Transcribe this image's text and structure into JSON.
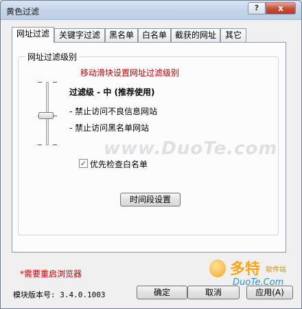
{
  "window": {
    "title": "黄色过滤"
  },
  "titlebar": {
    "help_label": "?",
    "close_label": "x"
  },
  "tabs": [
    {
      "label": "网址过滤",
      "active": true
    },
    {
      "label": "关键字过滤",
      "active": false
    },
    {
      "label": "黑名单",
      "active": false
    },
    {
      "label": "白名单",
      "active": false
    },
    {
      "label": "截获的网址",
      "active": false
    },
    {
      "label": "其它",
      "active": false
    }
  ],
  "group": {
    "title": "网址过滤级别",
    "hint": "移动滑块设置网址过滤级别",
    "level_title": "过滤级 - 中 (推荐使用)",
    "level_desc": [
      "- 禁止访问不良信息网站",
      "- 禁止访问黑名单网站"
    ],
    "slider_level": "中",
    "check_label": "优先检查白名单",
    "check_checked": true,
    "check_mark": "✓",
    "time_button": "时间段设置"
  },
  "footer": {
    "restart_note": "*需要重启浏览器",
    "version": "模块版本号: 3.4.0.1003",
    "ok_label": "确定",
    "cancel_label": "取消",
    "apply_label": "应用(A)"
  },
  "watermark": {
    "center": "www.DuoTe.com",
    "brand_cn": "多特",
    "brand_cn_small": "软件站",
    "brand_en": "DuoTe.Com"
  },
  "colors": {
    "hint": "#b80000",
    "restart_note": "#c00000",
    "brand_orange": "#f7a51c",
    "brand_blue": "#2d8ed8"
  }
}
